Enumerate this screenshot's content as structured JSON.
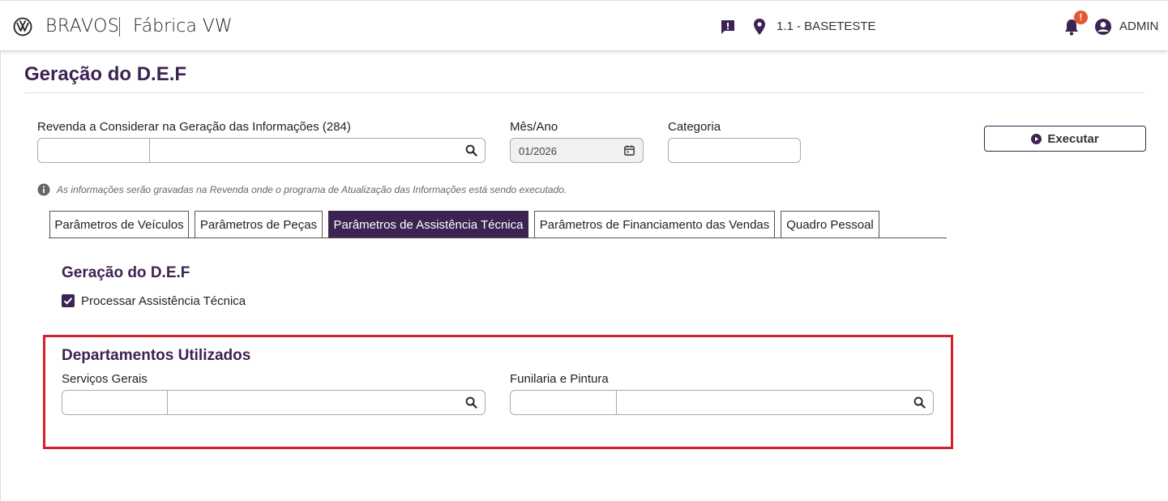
{
  "header": {
    "brand": "BRAVOS",
    "brand_sub": "Fábrica VW",
    "location": "1.1 - BASETESTE",
    "notification_badge": "!",
    "user": "ADMIN"
  },
  "page": {
    "title": "Geração do D.E.F"
  },
  "filters": {
    "revenda_label": "Revenda a Considerar na Geração das Informações (284)",
    "mes_ano_label": "Mês/Ano",
    "mes_ano_value": "01/2026",
    "categoria_label": "Categoria",
    "execute_label": "Executar"
  },
  "info_text": "As informações serão gravadas na Revenda onde o programa de Atualização das Informações está sendo executado.",
  "tabs": [
    {
      "label": "Parâmetros de Veículos",
      "active": false
    },
    {
      "label": "Parâmetros de Peças",
      "active": false
    },
    {
      "label": "Parâmetros de Assistência Técnica",
      "active": true
    },
    {
      "label": "Parâmetros de Financiamento das Vendas",
      "active": false
    },
    {
      "label": "Quadro Pessoal",
      "active": false
    }
  ],
  "section_def": {
    "title": "Geração do D.E.F",
    "checkbox_label": "Processar Assistência Técnica",
    "checked": true
  },
  "section_departments": {
    "title": "Departamentos Utilizados",
    "servicos_label": "Serviços Gerais",
    "funilaria_label": "Funilaria e Pintura"
  },
  "colors": {
    "primary": "#3c2352",
    "highlight": "#d6202a",
    "badge": "#e5562e"
  }
}
